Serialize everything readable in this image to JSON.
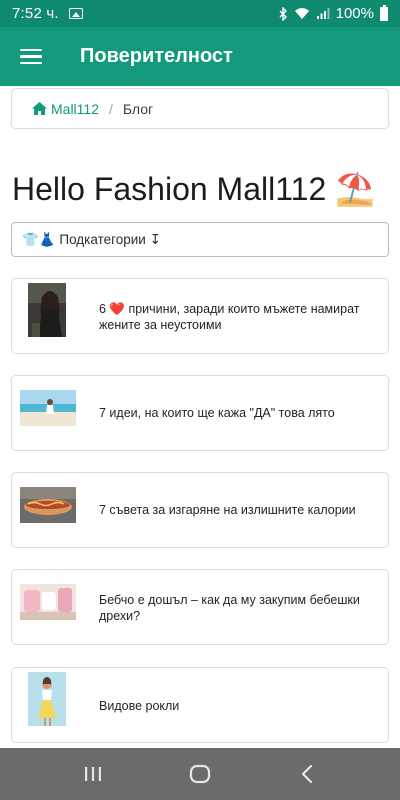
{
  "status_bar": {
    "time": "7:52 ч.",
    "battery_percent": "100%"
  },
  "app_bar": {
    "title": "Поверителност",
    "menu_icon": "hamburger-menu-icon"
  },
  "breadcrumb": {
    "home_label": "Mall112",
    "current_label": "Блог"
  },
  "page": {
    "title": "Hello Fashion Mall112 ⛱️",
    "subcategory_button": "👕👗 Подкатегории ↧"
  },
  "articles": [
    {
      "title": "6 ❤️ причини, заради които мъжете намират жените за неустоими",
      "thumb": "woman-portrait-image"
    },
    {
      "title": "7 идеи, на които ще кажа \"ДА\" това лято",
      "thumb": "beach-image"
    },
    {
      "title": "7 съвета за изгаряне на излишните калории",
      "thumb": "hotdog-image"
    },
    {
      "title": "Бебчо е дошъл – как да му закупим бебешки дрехи?",
      "thumb": "baby-clothes-image"
    },
    {
      "title": "Видове рокли",
      "thumb": "woman-dress-image"
    }
  ],
  "colors": {
    "status_bar": "#0f8a6f",
    "app_bar": "#13997b",
    "link": "#13997b",
    "nav_bar": "#6b6b6b"
  }
}
